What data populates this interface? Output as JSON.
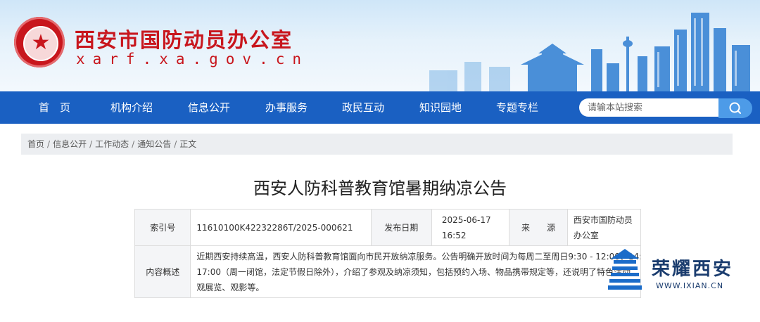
{
  "header": {
    "site_name": "西安市国防动员办公室",
    "site_domain": "xarf.xa.gov.cn",
    "emblem_ring_text": "NATIONAL DEFENSE MOBILIZATION"
  },
  "nav": {
    "items": [
      {
        "label": "首　页"
      },
      {
        "label": "机构介绍"
      },
      {
        "label": "信息公开"
      },
      {
        "label": "办事服务"
      },
      {
        "label": "政民互动"
      },
      {
        "label": "知识园地"
      },
      {
        "label": "专题专栏"
      }
    ],
    "search_placeholder": "请输本站搜索"
  },
  "breadcrumb": {
    "items": [
      "首页",
      "信息公开",
      "工作动态",
      "通知公告",
      "正文"
    ],
    "separator": "/"
  },
  "article": {
    "title": "西安人防科普教育馆暑期纳凉公告",
    "meta": {
      "index_label": "索引号",
      "index_value": "11610100K42232286T/2025-000621",
      "date_label": "发布日期",
      "date_value_line1": "2025-06-17",
      "date_value_line2": "16:52",
      "source_label": "来　　源",
      "source_value_line1": "西安市国防动员",
      "source_value_line2": "办公室",
      "summary_label": "内容概述",
      "summary_line1": "近期西安持续高温，西安人防科普教育馆面向市民开放纳凉服务。公告明确开放时间为每周二至周日9:30 - 12:00、14:30 -",
      "summary_line2": "17:00（周一闭馆，法定节假日除外），介绍了参观及纳凉须知，包括预约入场、物品携带规定等，还说明了特色活动，",
      "summary_line3": "观展览、观影等。"
    }
  },
  "watermark": {
    "text": "荣耀西安",
    "url": "WWW.IXIAN.CN"
  },
  "colors": {
    "brand_red": "#c8161d",
    "nav_blue": "#1a60c2",
    "search_button": "#4d9be8"
  }
}
